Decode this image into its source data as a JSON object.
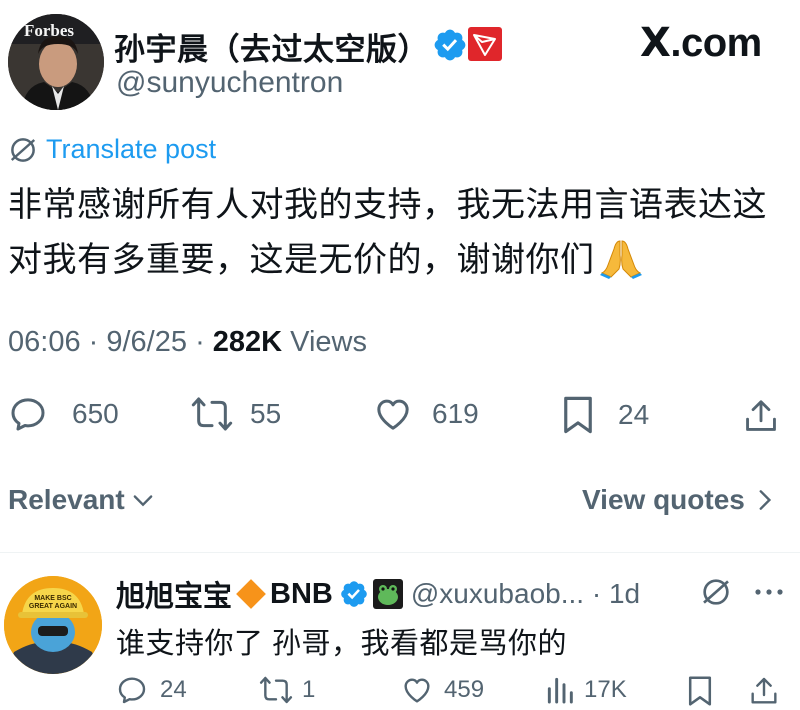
{
  "header": {
    "author_name": "孙宇晨（去过太空版）",
    "author_handle": "@sunyuchentron",
    "site_logo": "X.com",
    "site_logo_x": "X",
    "site_logo_rest": ".com",
    "avatar_caption": "Forbes"
  },
  "post": {
    "translate_label": "Translate post",
    "text_line1": "非常感谢所有人对我的支持，我无法用言语表达这",
    "text_line2": "对我有多重要，这是无价的，谢谢你们",
    "emoji": "pray-emoji",
    "time": "06:06",
    "date": "9/6/25",
    "views_count": "282K",
    "views_label": "Views",
    "replies": "650",
    "reposts": "55",
    "likes": "619",
    "bookmarks": "24"
  },
  "sort": {
    "relevant_label": "Relevant",
    "view_quotes_label": "View quotes"
  },
  "reply": {
    "name": "旭旭宝宝",
    "name_suffix": "BNB",
    "handle": "@xuxubaob...",
    "time": "1d",
    "text": "谁支持你了 孙哥，我看都是骂你的",
    "replies": "24",
    "reposts": "1",
    "likes": "459",
    "views": "17K",
    "avatar_cap_text_1": "MAKE BSC",
    "avatar_cap_text_2": "GREAT AGAIN"
  },
  "colors": {
    "accent": "#1d9bf0",
    "muted": "#536471",
    "text": "#0f1419",
    "tron_red": "#e0262b",
    "bnb_orange": "#f3ba2f"
  }
}
